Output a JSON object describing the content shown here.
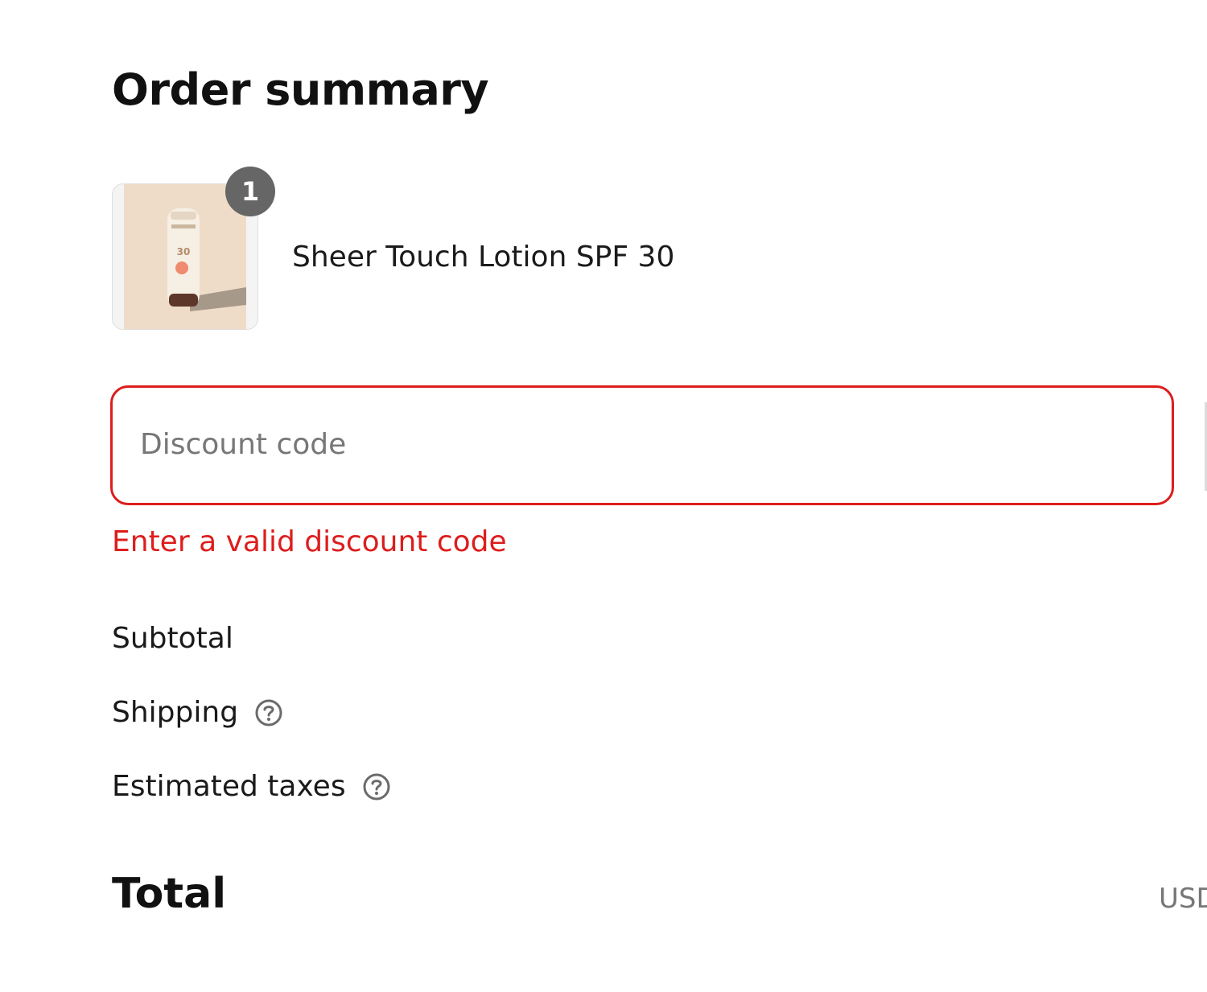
{
  "order_summary": {
    "title": "Order summary",
    "items": [
      {
        "name": "Sheer Touch Lotion SPF 30",
        "quantity": "1",
        "image_icon": "sunscreen-bottle-image"
      }
    ]
  },
  "discount": {
    "placeholder": "Discount code",
    "value": "",
    "error": "Enter a valid discount code",
    "error_color": "#dd1d1d"
  },
  "totals": {
    "subtotal_label": "Subtotal",
    "shipping_label": "Shipping",
    "taxes_label": "Estimated taxes",
    "help_icon": "question-circle-icon",
    "total_label": "Total",
    "currency": "USD"
  }
}
